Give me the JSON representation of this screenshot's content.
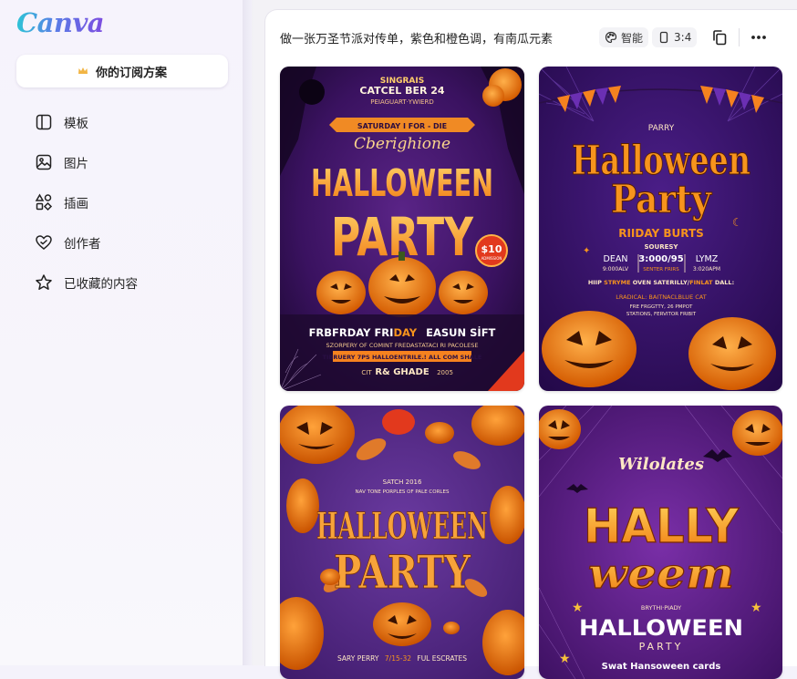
{
  "app": {
    "logo": "Canva"
  },
  "sidebar": {
    "subscription_label": "你的订阅方案",
    "items": [
      {
        "label": "模板",
        "icon": "template-icon"
      },
      {
        "label": "图片",
        "icon": "image-icon"
      },
      {
        "label": "插画",
        "icon": "shapes-icon"
      },
      {
        "label": "创作者",
        "icon": "heart-creator-icon"
      },
      {
        "label": "已收藏的内容",
        "icon": "star-icon"
      }
    ]
  },
  "toolbar": {
    "prompt": "做一张万圣节派对传单，紫色和橙色调，有南瓜元素",
    "style_label": "智能",
    "ratio_label": "3:4"
  },
  "posters": [
    {
      "line1": "SINGRAIS",
      "line2": "CATCEL BER 24",
      "line3": "PEIAGUART·YWIERD",
      "ribbon": "SATURDAY I FOR - DIE",
      "script": "Cberighione",
      "title1": "HALLOWEEN",
      "title2": "PARTY",
      "price": "$10",
      "price_sub": "ADMISSION",
      "footer1a": "FRBFRDAY FRI",
      "footer1b": "DAY",
      "footer1c": "EASUN SİFT",
      "footer2": "SZORPERY OF COMINT FREDASTATACI RI PACOLESE",
      "footer3": "TIBRUERY 7PS HALLOENTRILE.! ALL COM SHALE",
      "footer4": "R& GHADE",
      "footer4_left": "CIT",
      "footer4_right": "2005"
    },
    {
      "top": "PARRY",
      "title1": "Halloween",
      "title2": "Party",
      "subtitle": "RIIDAY BURTS",
      "souresy": "SOURESY",
      "col1a": "DEAN",
      "col1b": "9:000ALV",
      "col2a": "3:000/95",
      "col2b": "SENTER FRIRS",
      "col3a": "LYMZ",
      "col3b": "3:020APM",
      "line1a": "HIIP",
      "line1b": "STRYME",
      "line1c": "OVEN SATERILLY/",
      "line1d": "FINLAT",
      "line1e": "DALL:",
      "line2": "LRADICAL: BAITNACLBLUE CAT",
      "line3": "FRE FRGGTTY, 26 PMPOT",
      "line4": "STATIONS, FERVITOR FRIBIT"
    },
    {
      "top1": "SATCH 2016",
      "top2": "NAV TONE PORPLES OF PALE CORLES",
      "title1": "HALLOWEEN",
      "title2": "PARTY",
      "bottom_a": "SARY PERRY",
      "bottom_b": "7/15-32",
      "bottom_c": "FUL ESCRATES"
    },
    {
      "top": "Wilolates",
      "title1": "HALLY",
      "title2": "weem",
      "sub1": "BRYTHI·PIADY",
      "title3": "HALLOWEEN",
      "title4": "PARTY",
      "bottom": "Swat Hansoween cards"
    }
  ],
  "colors": {
    "purple_dark": "#2a0f45",
    "purple": "#5a1f8c",
    "orange": "#f5821f",
    "orange_light": "#ffb347",
    "cream": "#fde7c4"
  }
}
